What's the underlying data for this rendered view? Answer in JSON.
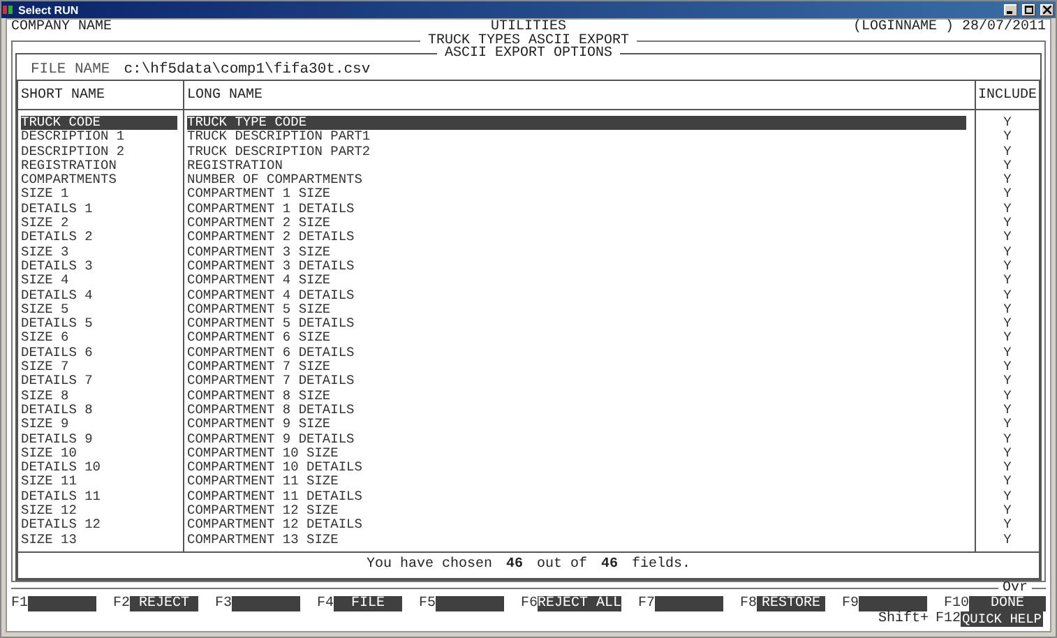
{
  "window": {
    "title": "Select RUN"
  },
  "header": {
    "company": "COMPANY NAME",
    "module": "UTILITIES",
    "user": "(LOGINNAME )",
    "date": "28/07/2011"
  },
  "screen_title": "TRUCK TYPES ASCII EXPORT",
  "panel_title": "ASCII EXPORT OPTIONS",
  "file_name": {
    "label": "FILE NAME",
    "value": "c:\\hf5data\\comp1\\fifa30t.csv"
  },
  "table": {
    "columns": [
      "SHORT NAME",
      "LONG NAME",
      "INCLUDE"
    ],
    "rows": [
      {
        "short": "TRUCK CODE",
        "long": "TRUCK TYPE CODE",
        "include": "Y",
        "selected": true
      },
      {
        "short": "DESCRIPTION 1",
        "long": "TRUCK DESCRIPTION PART1",
        "include": "Y",
        "selected": false
      },
      {
        "short": "DESCRIPTION 2",
        "long": "TRUCK DESCRIPTION PART2",
        "include": "Y",
        "selected": false
      },
      {
        "short": "REGISTRATION",
        "long": "REGISTRATION",
        "include": "Y",
        "selected": false
      },
      {
        "short": "COMPARTMENTS",
        "long": "NUMBER OF COMPARTMENTS",
        "include": "Y",
        "selected": false
      },
      {
        "short": "SIZE 1",
        "long": "COMPARTMENT 1 SIZE",
        "include": "Y",
        "selected": false
      },
      {
        "short": "DETAILS 1",
        "long": "COMPARTMENT 1 DETAILS",
        "include": "Y",
        "selected": false
      },
      {
        "short": "SIZE 2",
        "long": "COMPARTMENT 2 SIZE",
        "include": "Y",
        "selected": false
      },
      {
        "short": "DETAILS 2",
        "long": "COMPARTMENT 2 DETAILS",
        "include": "Y",
        "selected": false
      },
      {
        "short": "SIZE 3",
        "long": "COMPARTMENT 3 SIZE",
        "include": "Y",
        "selected": false
      },
      {
        "short": "DETAILS 3",
        "long": "COMPARTMENT 3 DETAILS",
        "include": "Y",
        "selected": false
      },
      {
        "short": "SIZE 4",
        "long": "COMPARTMENT 4 SIZE",
        "include": "Y",
        "selected": false
      },
      {
        "short": "DETAILS 4",
        "long": "COMPARTMENT 4 DETAILS",
        "include": "Y",
        "selected": false
      },
      {
        "short": "SIZE 5",
        "long": "COMPARTMENT 5 SIZE",
        "include": "Y",
        "selected": false
      },
      {
        "short": "DETAILS 5",
        "long": "COMPARTMENT 5 DETAILS",
        "include": "Y",
        "selected": false
      },
      {
        "short": "SIZE 6",
        "long": "COMPARTMENT 6 SIZE",
        "include": "Y",
        "selected": false
      },
      {
        "short": "DETAILS 6",
        "long": "COMPARTMENT 6 DETAILS",
        "include": "Y",
        "selected": false
      },
      {
        "short": "SIZE 7",
        "long": "COMPARTMENT 7 SIZE",
        "include": "Y",
        "selected": false
      },
      {
        "short": "DETAILS 7",
        "long": "COMPARTMENT 7 DETAILS",
        "include": "Y",
        "selected": false
      },
      {
        "short": "SIZE 8",
        "long": "COMPARTMENT 8 SIZE",
        "include": "Y",
        "selected": false
      },
      {
        "short": "DETAILS 8",
        "long": "COMPARTMENT 8 DETAILS",
        "include": "Y",
        "selected": false
      },
      {
        "short": "SIZE 9",
        "long": "COMPARTMENT 9 SIZE",
        "include": "Y",
        "selected": false
      },
      {
        "short": "DETAILS 9",
        "long": "COMPARTMENT 9 DETAILS",
        "include": "Y",
        "selected": false
      },
      {
        "short": "SIZE 10",
        "long": "COMPARTMENT 10 SIZE",
        "include": "Y",
        "selected": false
      },
      {
        "short": "DETAILS 10",
        "long": "COMPARTMENT 10 DETAILS",
        "include": "Y",
        "selected": false
      },
      {
        "short": "SIZE 11",
        "long": "COMPARTMENT 11 SIZE",
        "include": "Y",
        "selected": false
      },
      {
        "short": "DETAILS 11",
        "long": "COMPARTMENT 11 DETAILS",
        "include": "Y",
        "selected": false
      },
      {
        "short": "SIZE 12",
        "long": "COMPARTMENT 12 SIZE",
        "include": "Y",
        "selected": false
      },
      {
        "short": "DETAILS 12",
        "long": "COMPARTMENT 12 DETAILS",
        "include": "Y",
        "selected": false
      },
      {
        "short": "SIZE 13",
        "long": "COMPARTMENT 13 SIZE",
        "include": "Y",
        "selected": false
      }
    ]
  },
  "summary": {
    "prefix": "You have chosen",
    "chosen": "46",
    "middle": "out of",
    "total": "46",
    "suffix": "fields."
  },
  "mode": "Ovr",
  "function_keys": [
    {
      "key": "F1"
    },
    {
      "key": "F2",
      "label": "REJECT"
    },
    {
      "key": "F3"
    },
    {
      "key": "F4",
      "label": "FILE"
    },
    {
      "key": "F5"
    },
    {
      "key": "F6",
      "label": "REJECT ALL"
    },
    {
      "key": "F7"
    },
    {
      "key": "F8",
      "label": "RESTORE"
    },
    {
      "key": "F9"
    },
    {
      "key": "F10",
      "label": "DONE"
    }
  ],
  "shift_key": {
    "prefix": "Shift+",
    "key": "F12",
    "label": "QUICK HELP"
  }
}
